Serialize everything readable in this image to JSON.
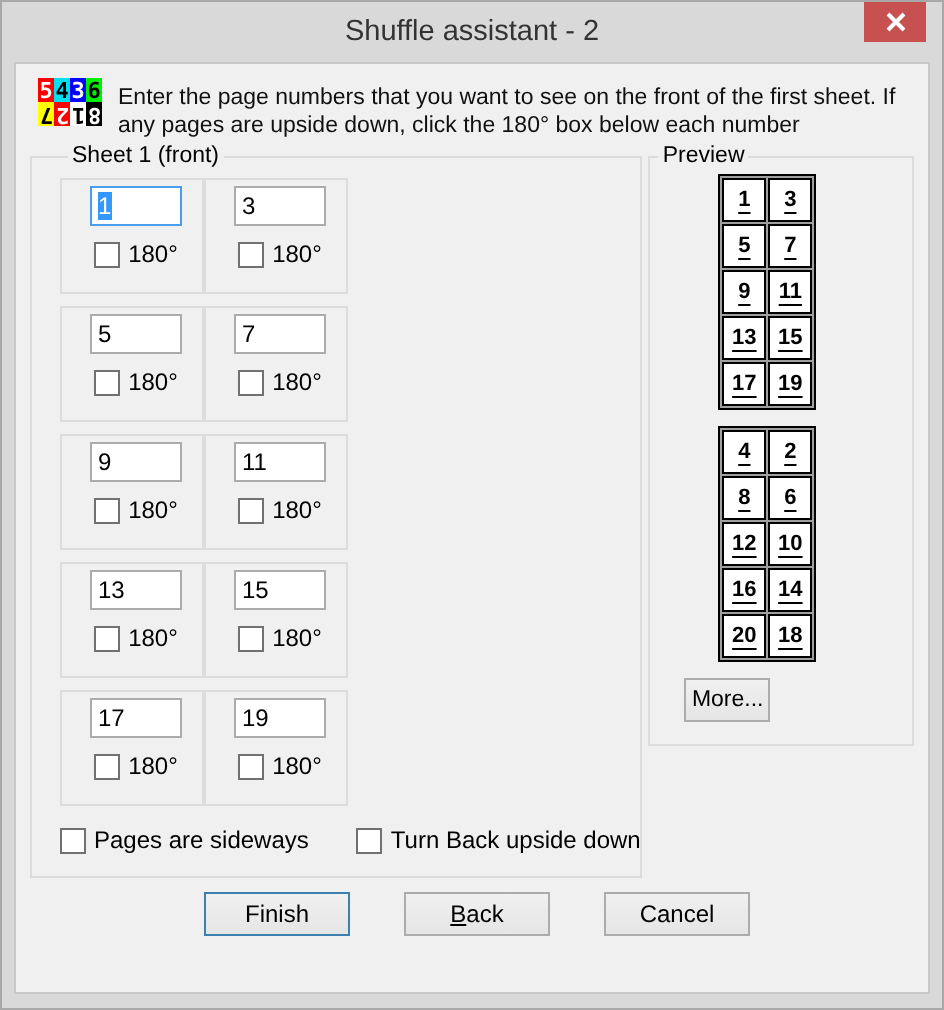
{
  "window": {
    "title": "Shuffle assistant - 2"
  },
  "logo": [
    {
      "digit": "5",
      "color": "#ff0000",
      "flipped": false
    },
    {
      "digit": "4",
      "color": "#00e0f0",
      "flipped": false
    },
    {
      "digit": "3",
      "color": "#0000ff",
      "flipped": false
    },
    {
      "digit": "6",
      "color": "#00ee00",
      "flipped": false
    },
    {
      "digit": "7",
      "color": "#ffff00",
      "flipped": true
    },
    {
      "digit": "2",
      "color": "#ff0000",
      "flipped": true
    },
    {
      "digit": "1",
      "color": "#ffffff",
      "flipped": true
    },
    {
      "digit": "8",
      "color": "#000000",
      "flipped": true
    }
  ],
  "instructions": "Enter the page numbers that you want to see on the front of the first sheet. If any pages are upside down, click the 180° box below each number",
  "sheet": {
    "title": "Sheet 1 (front)",
    "pages": [
      {
        "value": "1",
        "focused": true,
        "rotate_label": "180°",
        "checked": false
      },
      {
        "value": "3",
        "focused": false,
        "rotate_label": "180°",
        "checked": false
      },
      {
        "value": "5",
        "focused": false,
        "rotate_label": "180°",
        "checked": false
      },
      {
        "value": "7",
        "focused": false,
        "rotate_label": "180°",
        "checked": false
      },
      {
        "value": "9",
        "focused": false,
        "rotate_label": "180°",
        "checked": false
      },
      {
        "value": "11",
        "focused": false,
        "rotate_label": "180°",
        "checked": false
      },
      {
        "value": "13",
        "focused": false,
        "rotate_label": "180°",
        "checked": false
      },
      {
        "value": "15",
        "focused": false,
        "rotate_label": "180°",
        "checked": false
      },
      {
        "value": "17",
        "focused": false,
        "rotate_label": "180°",
        "checked": false
      },
      {
        "value": "19",
        "focused": false,
        "rotate_label": "180°",
        "checked": false
      }
    ],
    "options": [
      {
        "label": "Pages are sideways",
        "checked": false
      },
      {
        "label": "Turn Back upside down",
        "checked": false
      }
    ]
  },
  "preview": {
    "title": "Preview",
    "sheets": [
      [
        "1",
        "3",
        "5",
        "7",
        "9",
        "11",
        "13",
        "15",
        "17",
        "19"
      ],
      [
        "4",
        "2",
        "8",
        "6",
        "12",
        "10",
        "16",
        "14",
        "20",
        "18"
      ]
    ],
    "more_button": "More..."
  },
  "buttons": [
    {
      "label": "Finish",
      "default": true,
      "mnemonic": false
    },
    {
      "label": "Back",
      "default": false,
      "mnemonic": true
    },
    {
      "label": "Cancel",
      "default": false,
      "mnemonic": false
    }
  ]
}
